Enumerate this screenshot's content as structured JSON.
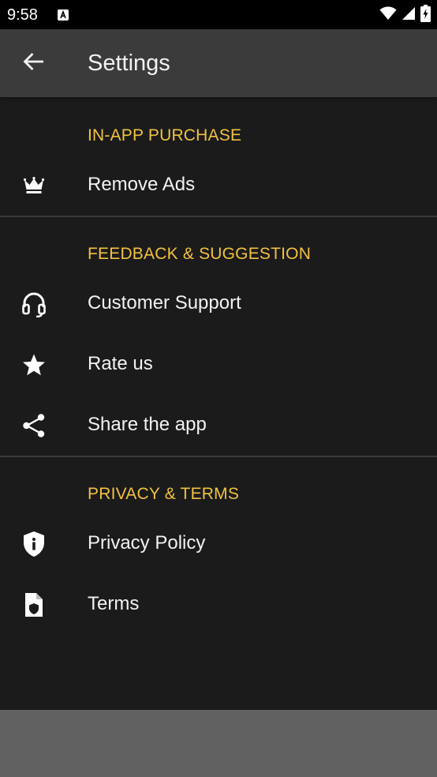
{
  "status_bar": {
    "time": "9:58",
    "notification_icon": "a-notification-icon",
    "wifi_icon": "wifi-icon",
    "signal_icon": "signal-icon",
    "battery_icon": "battery-charging-icon"
  },
  "app_bar": {
    "title": "Settings",
    "back_icon": "arrow-back-icon"
  },
  "sections": [
    {
      "header": "IN-APP PURCHASE",
      "items": [
        {
          "label": "Remove Ads",
          "icon": "crown-icon"
        }
      ]
    },
    {
      "header": "FEEDBACK & SUGGESTION",
      "items": [
        {
          "label": "Customer Support",
          "icon": "headset-icon"
        },
        {
          "label": "Rate us",
          "icon": "star-icon"
        },
        {
          "label": "Share the app",
          "icon": "share-icon"
        }
      ]
    },
    {
      "header": "PRIVACY & TERMS",
      "items": [
        {
          "label": "Privacy Policy",
          "icon": "shield-info-icon"
        },
        {
          "label": "Terms",
          "icon": "document-shield-icon"
        }
      ]
    }
  ],
  "colors": {
    "background": "#1b1b1c",
    "app_bar": "#3b3b3b",
    "accent": "#f2c23e",
    "text": "#f2f2f2",
    "divider": "#3a3a3a",
    "bottom_scrim": "#616161"
  }
}
